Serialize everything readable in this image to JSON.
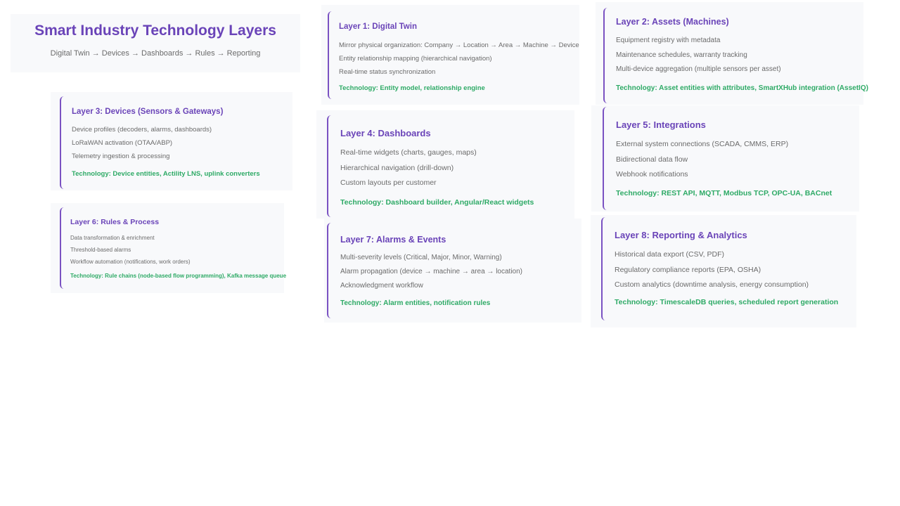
{
  "header": {
    "title": "Smart Industry Technology Layers",
    "subtitle": "Digital Twin → Devices → Dashboards → Rules → Reporting"
  },
  "layers": {
    "l1": {
      "title": "Layer 1: Digital Twin",
      "items": [
        "Mirror physical organization: Company → Location → Area → Machine → Device",
        "Entity relationship mapping (hierarchical navigation)",
        "Real-time status synchronization"
      ],
      "technology": "Technology: Entity model, relationship engine"
    },
    "l2": {
      "title": "Layer 2: Assets (Machines)",
      "items": [
        "Equipment registry with metadata",
        "Maintenance schedules, warranty tracking",
        "Multi-device aggregation (multiple sensors per asset)"
      ],
      "technology": "Technology: Asset entities with attributes, SmartXHub integration (AssetIQ)"
    },
    "l3": {
      "title": "Layer 3: Devices (Sensors & Gateways)",
      "items": [
        "Device profiles (decoders, alarms, dashboards)",
        "LoRaWAN activation (OTAA/ABP)",
        "Telemetry ingestion & processing"
      ],
      "technology": "Technology: Device entities, Actility LNS, uplink converters"
    },
    "l4": {
      "title": "Layer 4: Dashboards",
      "items": [
        "Real-time widgets (charts, gauges, maps)",
        "Hierarchical navigation (drill-down)",
        "Custom layouts per customer"
      ],
      "technology": "Technology: Dashboard builder, Angular/React widgets"
    },
    "l5": {
      "title": "Layer 5: Integrations",
      "items": [
        "External system connections (SCADA, CMMS, ERP)",
        "Bidirectional data flow",
        "Webhook notifications"
      ],
      "technology": "Technology: REST API, MQTT, Modbus TCP, OPC-UA, BACnet"
    },
    "l6": {
      "title": "Layer 6: Rules & Process",
      "items": [
        "Data transformation & enrichment",
        "Threshold-based alarms",
        "Workflow automation (notifications, work orders)"
      ],
      "technology": "Technology: Rule chains (node-based flow programming), Kafka message queue"
    },
    "l7": {
      "title": "Layer 7: Alarms & Events",
      "items": [
        "Multi-severity levels (Critical, Major, Minor, Warning)",
        "Alarm propagation (device → machine → area → location)",
        "Acknowledgment workflow"
      ],
      "technology": "Technology: Alarm entities, notification rules"
    },
    "l8": {
      "title": "Layer 8: Reporting & Analytics",
      "items": [
        "Historical data export (CSV, PDF)",
        "Regulatory compliance reports (EPA, OSHA)",
        "Custom analytics (downtime analysis, energy consumption)"
      ],
      "technology": "Technology: TimescaleDB queries, scheduled report generation"
    }
  }
}
